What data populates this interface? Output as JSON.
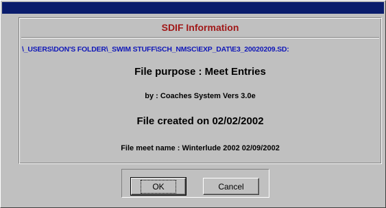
{
  "dialog": {
    "header": "SDIF Information",
    "file_path": "\\_USERS\\DON'S FOLDER\\_SWIM STUFF\\SCH_NMSC\\EXP_DAT\\E3_20020209.SD:",
    "purpose": "File purpose : Meet Entries",
    "by": "by : Coaches System Vers 3.0e",
    "created": "File created on 02/02/2002",
    "meet_name": "File meet name : Winterlude 2002 02/09/2002"
  },
  "buttons": {
    "ok": "OK",
    "cancel": "Cancel"
  },
  "colors": {
    "titlebar": "#0a1c6c",
    "header_text": "#a01818",
    "path_text": "#1018b8",
    "background": "#c0c0c0"
  }
}
